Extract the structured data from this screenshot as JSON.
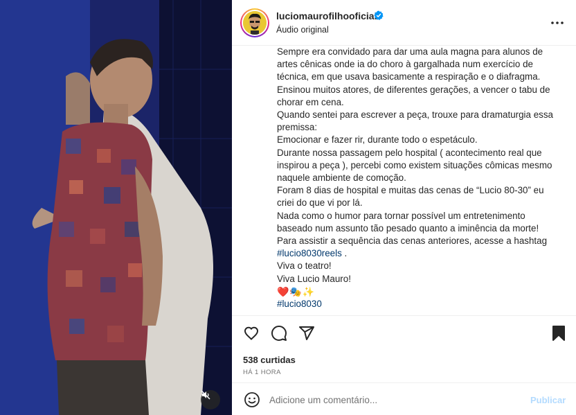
{
  "post": {
    "username": "luciomaurofilhooficial",
    "subtitle": "Áudio original",
    "icons": {
      "verified": "verified-badge-icon",
      "more": "more-options-icon",
      "mute": "mute-icon"
    }
  },
  "caption": {
    "lines": [
      "Sempre era convidado para dar uma aula magna para alunos de artes cênicas onde ia do choro à gargalhada num exercício de técnica, em que usava basicamente a respiração e o diafragma.",
      "Ensinou muitos atores, de diferentes gerações, a vencer o tabu de chorar em cena.",
      "Quando sentei para escrever a peça, trouxe para dramaturgia essa premissa:",
      "Emocionar e fazer rir, durante todo o espetáculo.",
      "Durante nossa passagem pelo hospital ( acontecimento real que inspirou a peça ), percebi como existem situações cômicas mesmo naquele ambiente de comoção.",
      "Foram 8 dias de hospital e muitas das cenas de “Lucio 80-30” eu criei do que vi por lá.",
      "Nada como o humor para tornar possível um entretenimento baseado num assunto tão pesado quanto a iminência da morte!",
      "Para assistir a sequência das cenas anteriores, acesse a hashtag"
    ],
    "hashtag_reels": "#lucio8030reels",
    "hashtag_reels_suffix": " .",
    "closing_1": "Viva o teatro!",
    "closing_2": "Viva Lucio Mauro!",
    "emojis": "❤️🎭✨",
    "hashtag": "#lucio8030"
  },
  "actions": {
    "icons": [
      "heart-icon",
      "comment-icon",
      "share-icon",
      "bookmark-icon"
    ],
    "likes": "538 curtidas",
    "time": "HÁ 1 HORA"
  },
  "comment": {
    "placeholder": "Adicione um comentário...",
    "publish_label": "Publicar",
    "emoji_icon": "emoji-icon"
  },
  "colors": {
    "link": "#00376b",
    "publish_disabled": "#b3dbff",
    "muted_text": "#737373",
    "border": "#efefef"
  }
}
